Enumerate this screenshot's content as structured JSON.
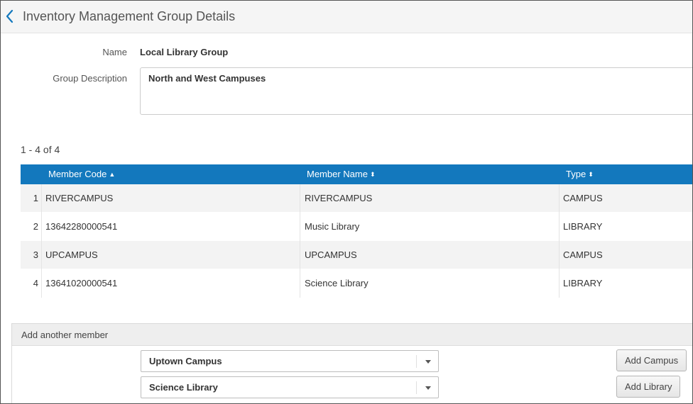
{
  "header": {
    "title": "Inventory Management Group Details"
  },
  "form": {
    "name_label": "Name",
    "name_value": "Local Library Group",
    "description_label": "Group Description",
    "description_value": "North and West Campuses"
  },
  "table": {
    "count_text": "1 - 4 of 4",
    "columns": [
      {
        "label": "Member Code",
        "sort": "▲"
      },
      {
        "label": "Member Name",
        "sort": "⬍"
      },
      {
        "label": "Type",
        "sort": "⬍"
      }
    ],
    "rows": [
      {
        "index": "1",
        "code": "RIVERCAMPUS",
        "name": "RIVERCAMPUS",
        "type": "CAMPUS"
      },
      {
        "index": "2",
        "code": "13642280000541",
        "name": "Music Library",
        "type": "LIBRARY"
      },
      {
        "index": "3",
        "code": "UPCAMPUS",
        "name": "UPCAMPUS",
        "type": "CAMPUS"
      },
      {
        "index": "4",
        "code": "13641020000541",
        "name": "Science Library",
        "type": "LIBRARY"
      }
    ]
  },
  "add_member": {
    "title": "Add another member",
    "campus_select_value": "Uptown Campus",
    "library_select_value": "Science Library",
    "add_campus_label": "Add Campus",
    "add_library_label": "Add Library"
  },
  "colors": {
    "table_header": "#1378bd",
    "back_arrow": "#1378bd"
  }
}
